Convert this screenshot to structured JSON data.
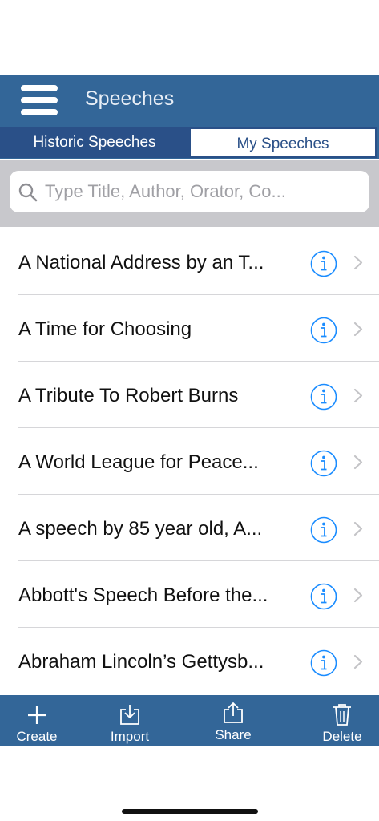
{
  "navbar": {
    "title": "Speeches",
    "menu_icon": "hamburger-menu-icon"
  },
  "segments": {
    "historic_label": "Historic Speeches",
    "my_label": "My Speeches",
    "selected": "My Speeches"
  },
  "search": {
    "placeholder": "Type Title, Author, Orator, Co...",
    "value": "",
    "icon": "search-icon"
  },
  "speeches": [
    {
      "title": "A National Address by an T..."
    },
    {
      "title": "A Time for Choosing"
    },
    {
      "title": "A Tribute To Robert Burns"
    },
    {
      "title": "A World League for Peace..."
    },
    {
      "title": "A speech by 85 year old, A..."
    },
    {
      "title": "Abbott's Speech Before the..."
    },
    {
      "title": "Abraham Lincoln’s Gettysb..."
    }
  ],
  "toolbar": {
    "create_label": "Create",
    "import_label": "Import",
    "share_label": "Share",
    "delete_label": "Delete"
  },
  "colors": {
    "bar": "#336698",
    "segment_selected_bg": "#2a5088",
    "info_accent": "#1a8cff",
    "search_band": "#c8c8cc"
  }
}
